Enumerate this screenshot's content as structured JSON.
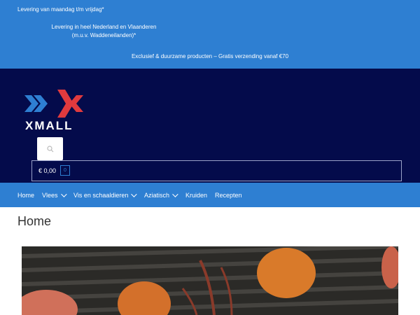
{
  "topbar": {
    "line1": "Levering van maandag t/m vrijdag*",
    "line2a": "Levering in heel Nederland en Vlaanderen",
    "line2b": "(m.u.v. Waddeneilanden)*",
    "line3": "Exclusief & duurzame producten – Gratis verzending vanaf €70"
  },
  "brand": {
    "name": "XMALL"
  },
  "search": {
    "icon": "search-icon"
  },
  "cart": {
    "amount": "€ 0,00",
    "count": "0"
  },
  "nav": {
    "items": [
      {
        "label": "Home"
      },
      {
        "label": "Vlees"
      },
      {
        "label": "Vis en schaaldieren"
      },
      {
        "label": "Aziatisch"
      },
      {
        "label": "Kruiden"
      },
      {
        "label": "Recepten"
      }
    ]
  },
  "page": {
    "title": "Home"
  },
  "colors": {
    "primary": "#2e7fd2",
    "header": "#040b4b",
    "logo_blue": "#2e7fd2",
    "logo_red": "#e03a3e"
  }
}
